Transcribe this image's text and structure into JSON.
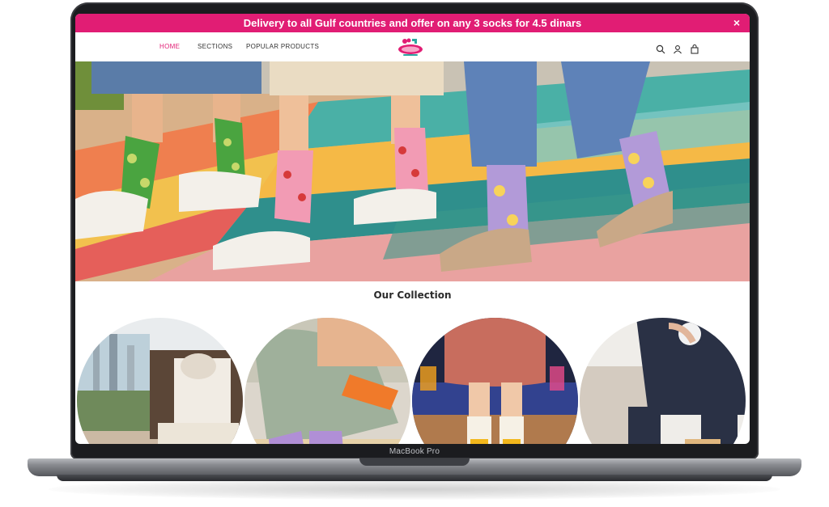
{
  "device": {
    "label": "MacBook Pro"
  },
  "promo": {
    "text": "Delivery to all Gulf countries and offer on any 3 socks for 4.5 dinars",
    "close_icon": "×"
  },
  "nav": {
    "items": [
      {
        "label": "HOME",
        "active": true
      },
      {
        "label": "SECTIONS",
        "active": false
      },
      {
        "label": "POPULAR PRODUCTS",
        "active": false
      }
    ],
    "icons": [
      "search-icon",
      "user-icon",
      "shopping-bag-icon"
    ]
  },
  "section": {
    "title": "Our Collection"
  },
  "colors": {
    "promo_bg": "#e11d74",
    "nav_active": "#e11d74"
  }
}
